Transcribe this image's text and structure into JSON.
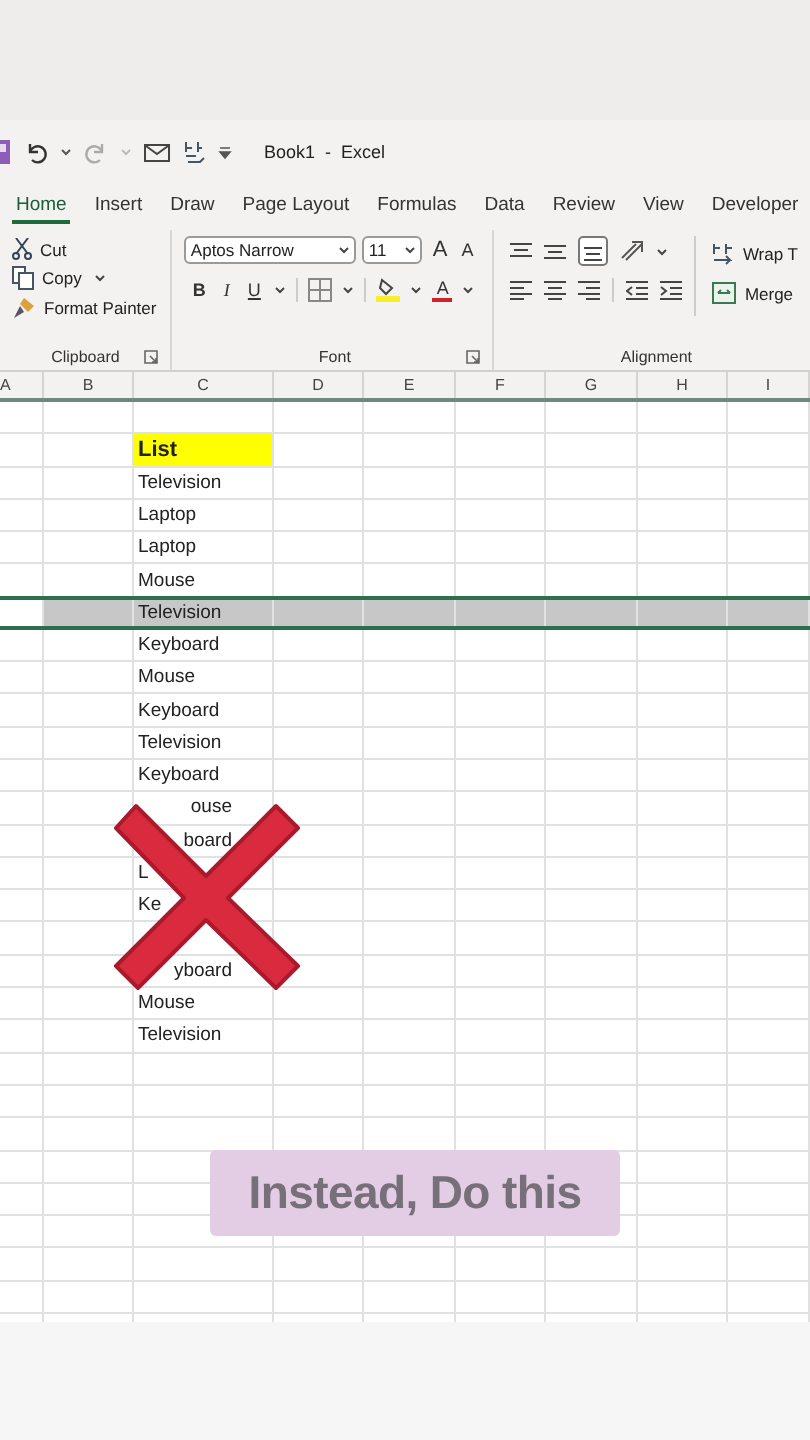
{
  "window": {
    "title": "Book1  -  Excel"
  },
  "tabs": [
    {
      "label": "Home",
      "selected": true
    },
    {
      "label": "Insert",
      "selected": false
    },
    {
      "label": "Draw",
      "selected": false
    },
    {
      "label": "Page Layout",
      "selected": false
    },
    {
      "label": "Formulas",
      "selected": false
    },
    {
      "label": "Data",
      "selected": false
    },
    {
      "label": "Review",
      "selected": false
    },
    {
      "label": "View",
      "selected": false
    },
    {
      "label": "Developer",
      "selected": false
    }
  ],
  "clipboard": {
    "label": "Clipboard",
    "items": [
      {
        "label": "Cut",
        "kind": "cut"
      },
      {
        "label": "Copy",
        "kind": "copy"
      },
      {
        "label": "Format Painter",
        "kind": "painter"
      }
    ]
  },
  "font": {
    "label": "Font",
    "name": "Aptos Narrow",
    "size": "11",
    "grow": "A",
    "shrink": "A",
    "bold": "B",
    "italic": "I",
    "underline": "U",
    "font_color": "A"
  },
  "alignment": {
    "label": "Alignment",
    "wrap": "Wrap T",
    "merge": "Merge"
  },
  "sheet": {
    "columns": [
      "A",
      "B",
      "C",
      "D",
      "E",
      "F",
      "G",
      "H",
      "I"
    ],
    "rows": [
      {
        "kind": "blank",
        "selected": false
      },
      {
        "kind": "heading",
        "value": "List",
        "selected": false
      },
      {
        "kind": "item",
        "value": "Television",
        "selected": false
      },
      {
        "kind": "item",
        "value": "Laptop",
        "selected": false
      },
      {
        "kind": "item",
        "value": "Laptop",
        "selected": false
      },
      {
        "kind": "item",
        "value": "Mouse",
        "selected": false
      },
      {
        "kind": "item",
        "value": "Television",
        "selected": true
      },
      {
        "kind": "item",
        "value": "Keyboard",
        "selected": false
      },
      {
        "kind": "item",
        "value": "Mouse",
        "selected": false
      },
      {
        "kind": "item",
        "value": "Keyboard",
        "selected": false
      },
      {
        "kind": "item",
        "value": "Television",
        "selected": false
      },
      {
        "kind": "item",
        "value": "Keyboard",
        "selected": false
      },
      {
        "kind": "tail",
        "value": "ouse",
        "selected": false
      },
      {
        "kind": "tail",
        "value": "board",
        "selected": false
      },
      {
        "kind": "item",
        "value": "L",
        "selected": false
      },
      {
        "kind": "item",
        "value": "Ke",
        "selected": false
      },
      {
        "kind": "blank",
        "selected": false
      },
      {
        "kind": "tail",
        "value": "yboard",
        "selected": false
      },
      {
        "kind": "item",
        "value": "Mouse",
        "selected": false
      },
      {
        "kind": "item",
        "value": "Television",
        "selected": false
      }
    ]
  },
  "callout": {
    "text": "Instead, Do this"
  }
}
